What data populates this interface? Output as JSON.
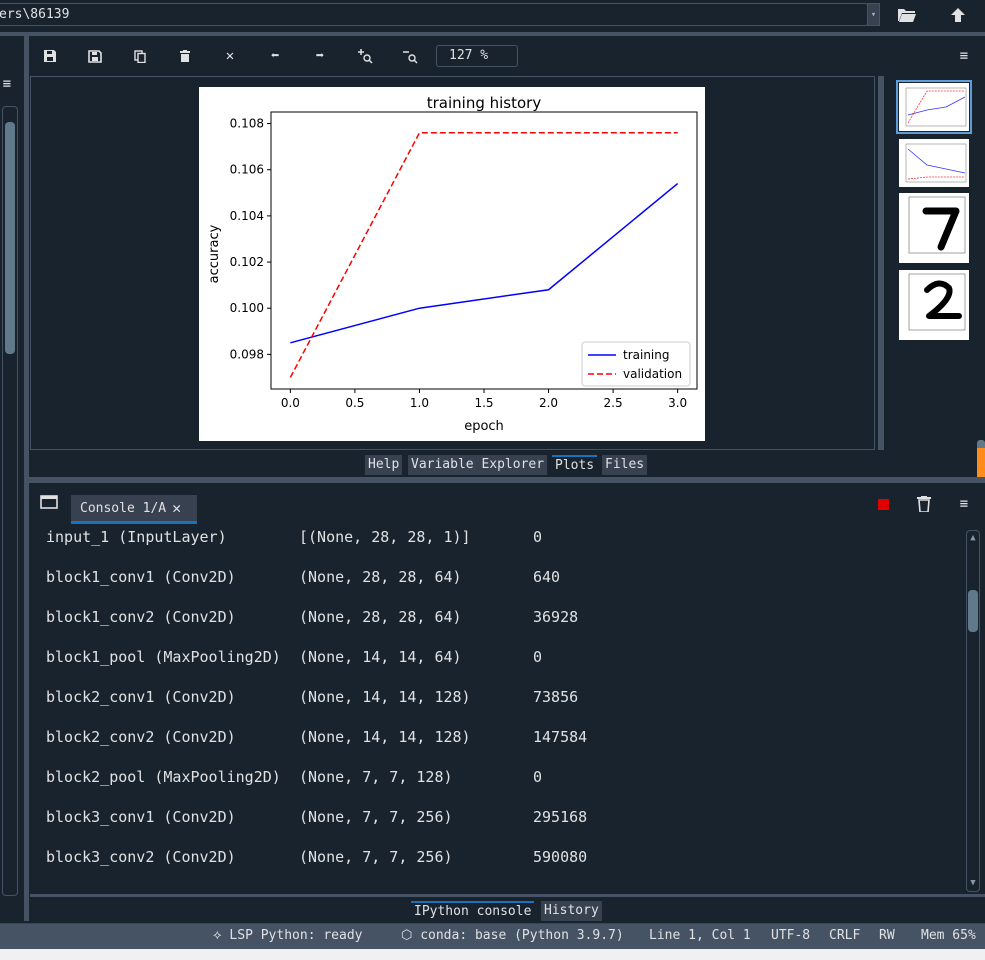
{
  "path_bar": {
    "path": "ers\\86139"
  },
  "plots_toolbar": {
    "zoom": "127 %"
  },
  "pane_tabs": [
    {
      "label": "Help"
    },
    {
      "label": "Variable Explorer"
    },
    {
      "label": "Plots"
    },
    {
      "label": "Files"
    }
  ],
  "console": {
    "tab_label": "Console 1/A",
    "rows": [
      {
        "layer": "input_1 (InputLayer)",
        "shape": "[(None, 28, 28, 1)]",
        "params": "0"
      },
      {
        "layer": "block1_conv1 (Conv2D)",
        "shape": "(None, 28, 28, 64)",
        "params": "640"
      },
      {
        "layer": "block1_conv2 (Conv2D)",
        "shape": "(None, 28, 28, 64)",
        "params": "36928"
      },
      {
        "layer": "block1_pool (MaxPooling2D)",
        "shape": "(None, 14, 14, 64)",
        "params": "0"
      },
      {
        "layer": "block2_conv1 (Conv2D)",
        "shape": "(None, 14, 14, 128)",
        "params": "73856"
      },
      {
        "layer": "block2_conv2 (Conv2D)",
        "shape": "(None, 14, 14, 128)",
        "params": "147584"
      },
      {
        "layer": "block2_pool (MaxPooling2D)",
        "shape": "(None, 7, 7, 128)",
        "params": "0"
      },
      {
        "layer": "block3_conv1 (Conv2D)",
        "shape": "(None, 7, 7, 256)",
        "params": "295168"
      },
      {
        "layer": "block3_conv2 (Conv2D)",
        "shape": "(None, 7, 7, 256)",
        "params": "590080"
      }
    ]
  },
  "console_tabs": [
    {
      "label": "IPython console"
    },
    {
      "label": "History"
    }
  ],
  "status": {
    "lsp": "LSP Python: ready",
    "conda": "conda: base (Python 3.9.7)",
    "position": "Line 1, Col 1",
    "encoding": "UTF-8",
    "eol": "CRLF",
    "mode": "RW",
    "mem": "Mem 65%"
  },
  "colors": {
    "background": "#19232d",
    "border": "#455364",
    "accent": "#1a72bb",
    "training_line": "#0000ff",
    "validation_line": "#ff0000",
    "stop_button": "#e00000"
  },
  "chart_data": {
    "type": "line",
    "title": "training history",
    "xlabel": "epoch",
    "ylabel": "accuracy",
    "x": [
      0,
      1,
      2,
      3
    ],
    "xlim": [
      -0.15,
      3.15
    ],
    "ylim": [
      0.0965,
      0.1085
    ],
    "xticks": [
      "0.0",
      "0.5",
      "1.0",
      "1.5",
      "2.0",
      "2.5",
      "3.0"
    ],
    "yticks": [
      "0.098",
      "0.100",
      "0.102",
      "0.104",
      "0.106",
      "0.108"
    ],
    "series": [
      {
        "name": "training",
        "values": [
          0.0985,
          0.1,
          0.1008,
          0.1054
        ],
        "color": "#0000ff",
        "style": "solid"
      },
      {
        "name": "validation",
        "values": [
          0.097,
          0.1076,
          0.1076,
          0.1076
        ],
        "color": "#ff0000",
        "style": "dashed"
      }
    ],
    "legend_position": "lower-right",
    "grid": false
  }
}
